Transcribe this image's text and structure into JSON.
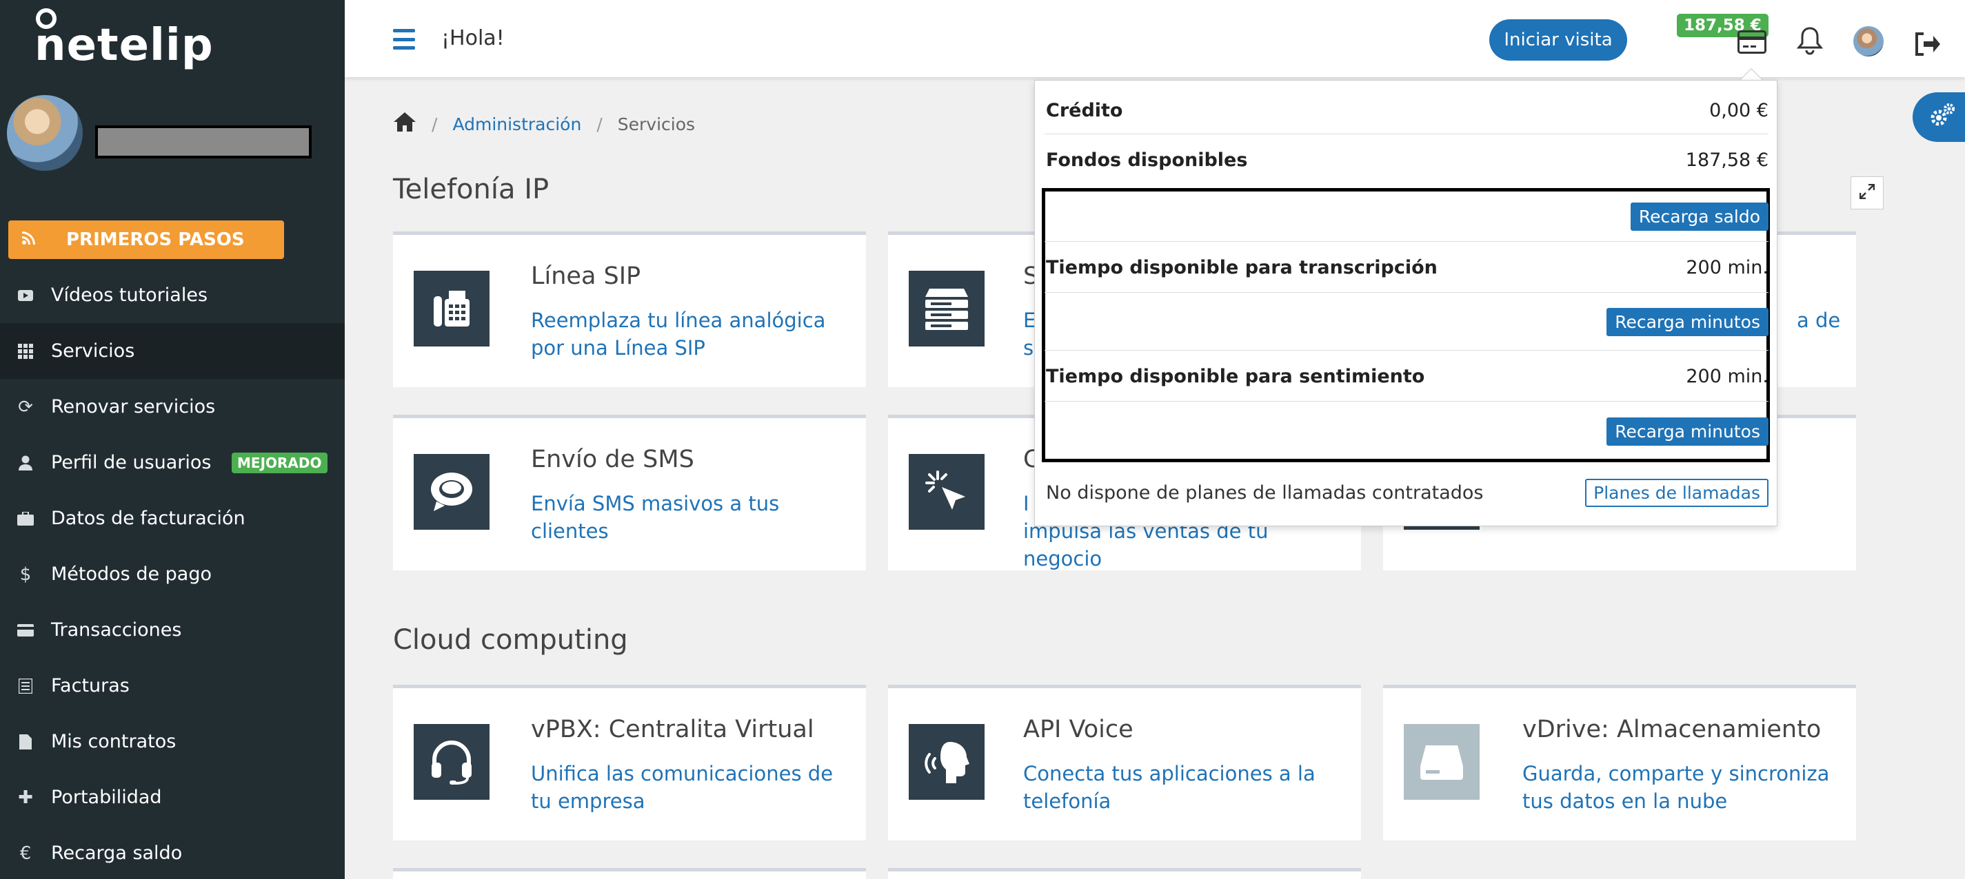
{
  "brand": {
    "logo_text": "netelip"
  },
  "sidebar": {
    "primeros_pasos": "PRIMEROS PASOS",
    "items": [
      {
        "label": "Vídeos tutoriales",
        "icon": "video-icon"
      },
      {
        "label": "Servicios",
        "icon": "grid-icon",
        "active": true
      },
      {
        "label": "Renovar servicios",
        "icon": "refresh-icon"
      },
      {
        "label": "Perfil de usuarios",
        "icon": "user-icon",
        "badge": "MEJORADO"
      },
      {
        "label": "Datos de facturación",
        "icon": "briefcase-icon"
      },
      {
        "label": "Métodos de pago",
        "icon": "dollar-icon"
      },
      {
        "label": "Transacciones",
        "icon": "card-icon"
      },
      {
        "label": "Facturas",
        "icon": "list-icon"
      },
      {
        "label": "Mis contratos",
        "icon": "file-icon"
      },
      {
        "label": "Portabilidad",
        "icon": "plus-icon"
      },
      {
        "label": "Recarga saldo",
        "icon": "euro-icon"
      }
    ]
  },
  "header": {
    "greeting": "¡Hola!",
    "visit_button": "Iniciar visita",
    "balance": "187,58 €"
  },
  "breadcrumb": {
    "admin": "Administración",
    "current": "Servicios"
  },
  "sections": {
    "telefonia": "Telefonía IP",
    "cloud": "Cloud computing"
  },
  "cards": {
    "linea_sip": {
      "title": "Línea SIP",
      "desc": "Reemplaza tu línea analógica por una Línea SIP"
    },
    "card2_title_frag": "S",
    "card2_desc_frag": "E",
    "card2_desc_frag2": "s",
    "card3_desc_frag": "a de",
    "sms": {
      "title": "Envío de SMS",
      "desc": "Envía SMS masivos a tus clientes"
    },
    "card5_title_frag": "C",
    "card5_desc_frag": "I",
    "card5_desc_frag2": "impulsa las ventas de tu negocio",
    "vpbx": {
      "title": "vPBX: Centralita Virtual",
      "desc": "Unifica las comunicaciones de tu empresa"
    },
    "api_voice": {
      "title": "API Voice",
      "desc": "Conecta tus aplicaciones a la telefonía"
    },
    "vdrive": {
      "title": "vDrive: Almacenamiento",
      "desc": "Guarda, comparte y sincroniza tus datos en la nube"
    }
  },
  "dropdown": {
    "credito_label": "Crédito",
    "credito_value": "0,00 €",
    "fondos_label": "Fondos disponibles",
    "fondos_value": "187,58 €",
    "recarga_saldo": "Recarga saldo",
    "transcripcion_label": "Tiempo disponible para transcripción",
    "transcripcion_value": "200 min.",
    "recarga_minutos": "Recarga minutos",
    "sentimiento_label": "Tiempo disponible para sentimiento",
    "sentimiento_value": "200 min.",
    "no_planes": "No dispone de planes de llamadas contratados",
    "planes_button": "Planes de llamadas"
  },
  "colors": {
    "brand_blue": "#1f73b7",
    "sidebar_bg": "#222d32",
    "accent_orange": "#f39c34",
    "success_green": "#4caf50"
  }
}
